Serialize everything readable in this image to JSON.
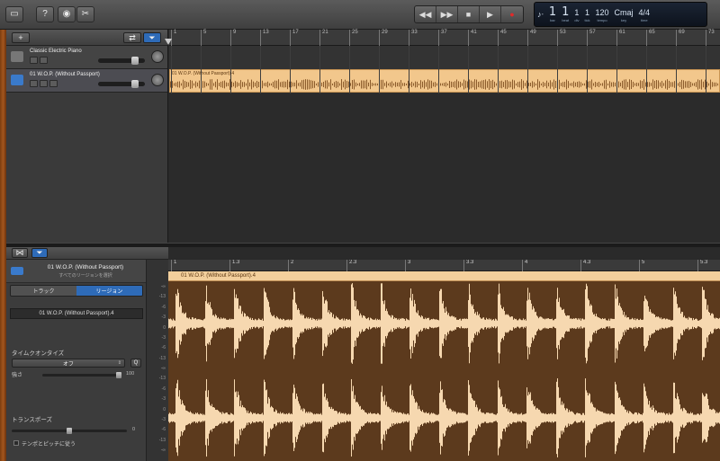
{
  "toolbar": {
    "transport": [
      "rewind",
      "fast-forward",
      "stop",
      "play",
      "record"
    ],
    "lcd": {
      "bar": "1",
      "beat": "1",
      "div": "1",
      "tick": "1",
      "bar_label": "bar",
      "beat_label": "beat",
      "div_label": "div",
      "tick_label": "tick",
      "tempo": "120",
      "tempo_label": "tempo",
      "key": "Cmaj",
      "key_label": "key",
      "signature": "4/4",
      "signature_label": "time"
    }
  },
  "track_header": {
    "add_label": "+",
    "tracks": [
      {
        "name": "Classic Electric Piano",
        "volume": 0.85
      },
      {
        "name": "01 W.O.P. (Without Passport)",
        "volume": 0.85
      }
    ]
  },
  "arrange": {
    "ruler": [
      "1",
      "5",
      "9",
      "13",
      "17",
      "21",
      "25",
      "29",
      "33",
      "37",
      "41",
      "45",
      "49",
      "53",
      "57",
      "61",
      "65",
      "69",
      "73"
    ],
    "region_label": "01 W.O.P. (Without Passport).4"
  },
  "inspector": {
    "title": "01 W.O.P. (Without Passport)",
    "subtitle": "すべてのリージョンを選択",
    "tab_track": "トラック",
    "tab_region": "リージョン",
    "region_name": "01 W.O.P. (Without Passport).4",
    "quantize_label": "タイムクオンタイズ",
    "quantize_value": "オフ",
    "quantize_button": "Q",
    "strength_label": "強さ",
    "strength_value": "100",
    "transpose_label": "トランスポーズ",
    "transpose_value": "0",
    "follow_tempo_label": "テンポとピッチに従う"
  },
  "db_scale": [
    "-∞",
    "-13",
    "-6",
    "-3",
    "0",
    "-3",
    "-6",
    "-13",
    "-∞",
    "-13",
    "-6",
    "-3",
    "0",
    "-3",
    "-6",
    "-13",
    "-∞"
  ],
  "editor": {
    "ruler": [
      "1",
      "1.3",
      "2",
      "2.3",
      "3",
      "3.3",
      "4",
      "4.3",
      "5",
      "5.3"
    ],
    "region_label": "01 W.O.P. (Without Passport).4"
  },
  "colors": {
    "region": "#f2c78c",
    "waveform_bg": "#5c3a1d",
    "waveform": "#f6d8b0",
    "selected_tab": "#2e6bb8",
    "track_icon_audio": "#3a7acb"
  }
}
